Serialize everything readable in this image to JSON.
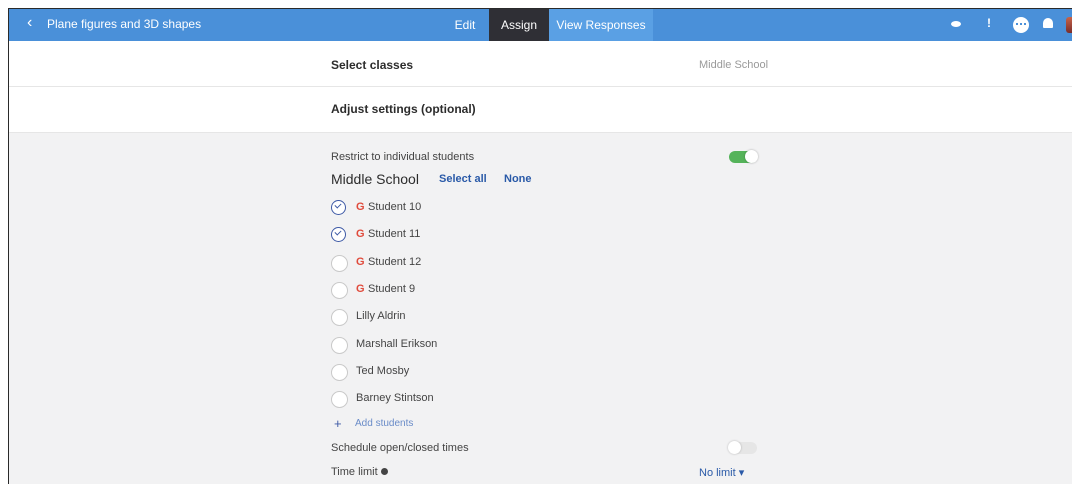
{
  "header": {
    "back_icon": "chevron-left-icon",
    "lesson_title": "Plane figures and 3D shapes",
    "tabs": [
      "Edit",
      "Assign",
      "View Responses"
    ],
    "info_glyph": "!",
    "icons": [
      "eye-icon",
      "info-icon",
      "chat-icon",
      "bell-icon",
      "avatar"
    ],
    "colors": {
      "bar": "#4a90d9",
      "active_tab": "#2f2f35",
      "responses_tab": "#5aa0e4"
    }
  },
  "select_classes": {
    "label": "Select classes",
    "value": "Middle School"
  },
  "adjust": {
    "label": "Adjust settings (optional)"
  },
  "settings": {
    "restrict_label": "Restrict to individual students",
    "restrict_on": true,
    "class_name": "Middle School",
    "select_all": "Select all",
    "none": "None",
    "google_mark": "G",
    "students": [
      {
        "name": "Student 10",
        "google": true,
        "checked": true
      },
      {
        "name": "Student 11",
        "google": true,
        "checked": true
      },
      {
        "name": "Student 12",
        "google": true,
        "checked": false
      },
      {
        "name": "Student 9",
        "google": true,
        "checked": false
      },
      {
        "name": "Lilly Aldrin",
        "google": false,
        "checked": false
      },
      {
        "name": "Marshall Erikson",
        "google": false,
        "checked": false
      },
      {
        "name": "Ted Mosby",
        "google": false,
        "checked": false
      },
      {
        "name": "Barney Stintson",
        "google": false,
        "checked": false
      }
    ],
    "add_students": "Add students",
    "schedule_label": "Schedule open/closed times",
    "schedule_on": false,
    "time_limit_label": "Time limit",
    "time_limit_value": "No limit"
  }
}
